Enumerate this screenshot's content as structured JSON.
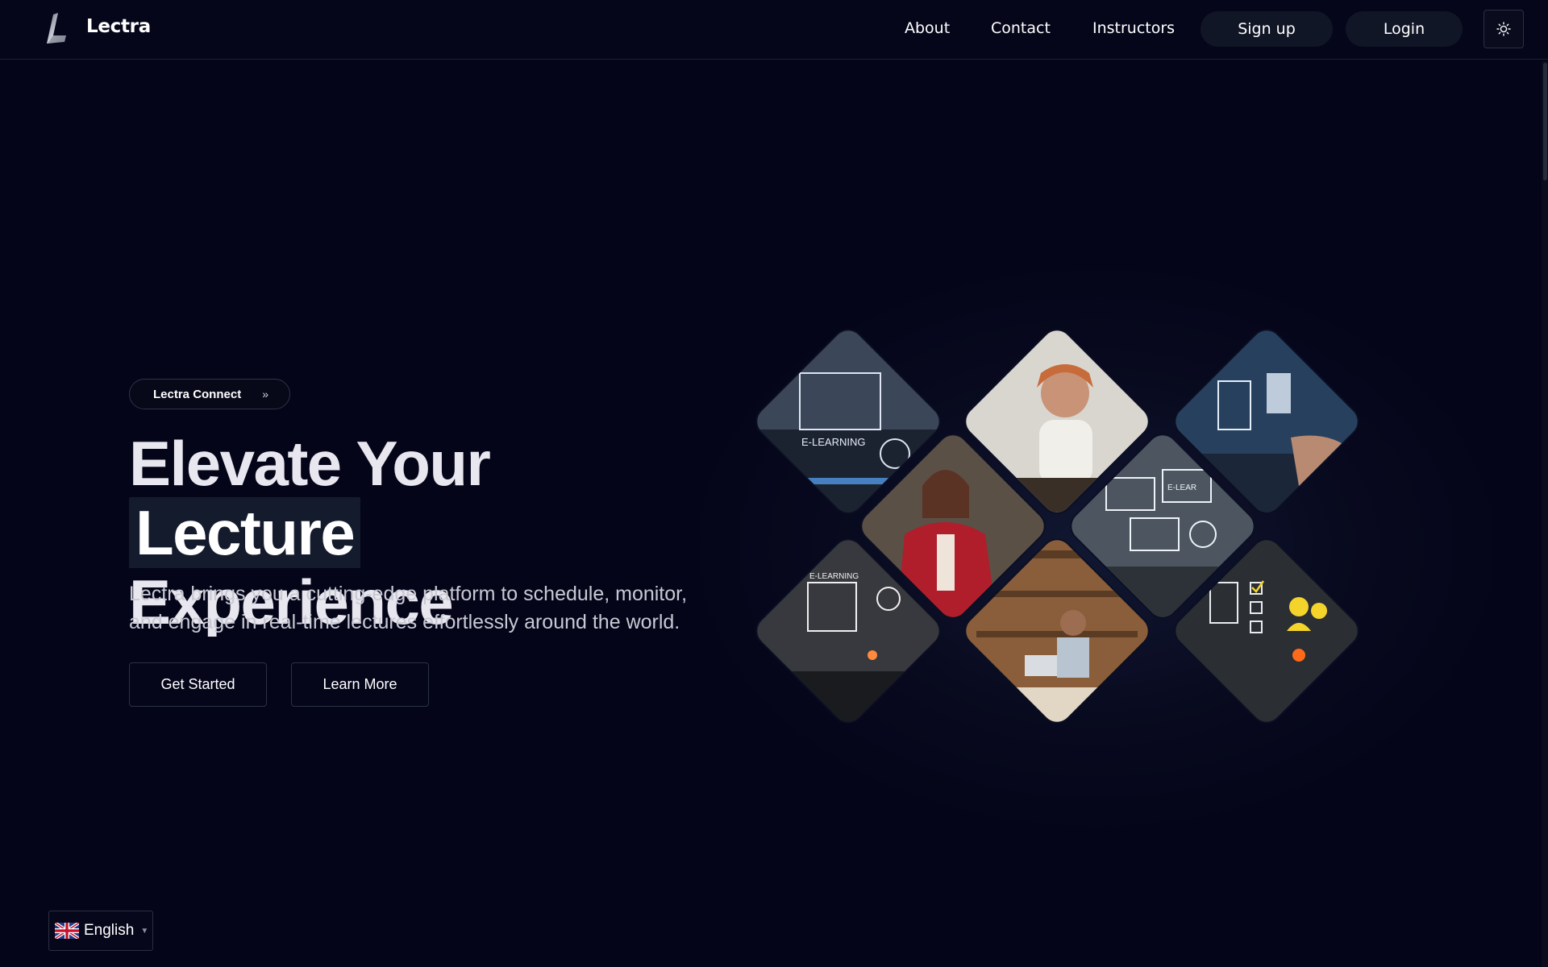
{
  "app": {
    "brand": "Lectra"
  },
  "nav": {
    "links": [
      "About",
      "Contact",
      "Instructors"
    ],
    "signup": "Sign up",
    "login": "Login",
    "theme_icon": "sun-icon"
  },
  "hero": {
    "badge": "Lectra Connect",
    "badge_icon": "double-chevron-right-icon",
    "headline_pre": "Elevate Your",
    "headline_highlight": "Lecture",
    "headline_post": "Experience",
    "subtitle_line1": "Lectra brings you a cutting-edge platform to schedule, monitor,",
    "subtitle_line2": "and engage in real-time lectures effortlessly around the world.",
    "primary_cta": "Get Started",
    "secondary_cta": "Learn More",
    "image_tile_labels": [
      "E-LEARNING",
      "E-LEARNING",
      "E-LEAR"
    ]
  },
  "language": {
    "selected": "English",
    "flag_icon": "uk-flag-icon"
  },
  "colors": {
    "background": "#05051a",
    "highlight_bg": "#141b2c",
    "pill_bg": "#111626",
    "border": "#2c3144",
    "accent_yellow": "#f4d42b"
  }
}
